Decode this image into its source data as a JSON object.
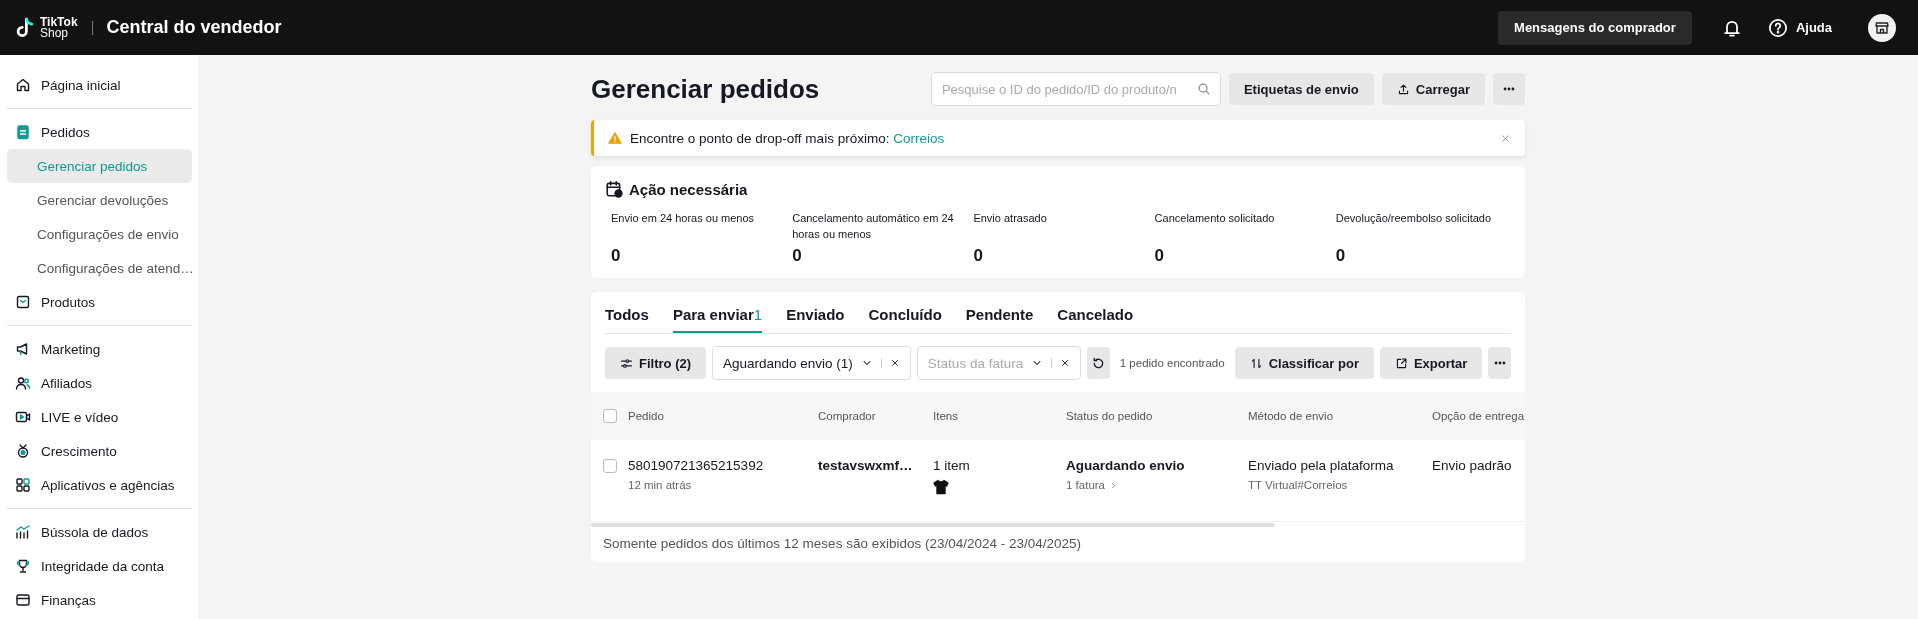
{
  "header": {
    "logo_top": "TikTok",
    "logo_bottom": "Shop",
    "title": "Central do vendedor",
    "messages_button": "Mensagens do comprador",
    "help": "Ajuda"
  },
  "sidebar": {
    "groups": [
      [
        {
          "label": "Página inicial"
        }
      ],
      [
        {
          "label": "Pedidos",
          "children": [
            {
              "label": "Gerenciar pedidos",
              "selected": true
            },
            {
              "label": "Gerenciar devoluções",
              "selected": false
            },
            {
              "label": "Configurações de envio",
              "selected": false
            },
            {
              "label": "Configurações de atend…",
              "selected": false
            }
          ]
        },
        {
          "label": "Produtos"
        }
      ],
      [
        {
          "label": "Marketing"
        },
        {
          "label": "Afiliados"
        },
        {
          "label": "LIVE e vídeo"
        },
        {
          "label": "Crescimento"
        },
        {
          "label": "Aplicativos e agências"
        }
      ],
      [
        {
          "label": "Bússola de dados"
        },
        {
          "label": "Integridade da conta"
        },
        {
          "label": "Finanças"
        }
      ]
    ]
  },
  "page": {
    "title": "Gerenciar pedidos",
    "search": {
      "placeholder": "Pesquise o ID do pedido/ID do produto/n"
    },
    "buttons": [
      "Etiquetas de envio",
      "Carregar"
    ]
  },
  "alert": {
    "text": "Encontre o ponto de drop-off mais próximo:",
    "link": "Correios"
  },
  "action_needed": {
    "title": "Ação necessária",
    "metrics": [
      {
        "label": "Envio em 24 horas ou menos",
        "value": "0"
      },
      {
        "label": "Cancelamento automático em 24 horas ou menos",
        "value": "0"
      },
      {
        "label": "Envio atrasado",
        "value": "0"
      },
      {
        "label": "Cancelamento solicitado",
        "value": "0"
      },
      {
        "label": "Devolução/reembolso solicitado",
        "value": "0"
      }
    ]
  },
  "tabs": [
    {
      "label": "Todos",
      "selected": false
    },
    {
      "label": "Para enviar",
      "count": "1",
      "selected": true
    },
    {
      "label": "Enviado",
      "selected": false
    },
    {
      "label": "Concluído",
      "selected": false
    },
    {
      "label": "Pendente",
      "selected": false
    },
    {
      "label": "Cancelado",
      "selected": false
    }
  ],
  "filters": {
    "filter_button": "Filtro",
    "filter_count": "(2)",
    "dropdowns": [
      {
        "value": "Aguardando envio (1)"
      },
      {
        "placeholder": "Status da fatura"
      }
    ],
    "result": "1 pedido encontrado",
    "sort_button": "Classificar por",
    "export_button": "Exportar"
  },
  "table": {
    "columns": [
      "Pedido",
      "Comprador",
      "Itens",
      "Status do pedido",
      "Método de envio",
      "Opção de entrega"
    ],
    "all_checked": false,
    "rows": [
      {
        "checked": false,
        "order_id": "580190721365215392",
        "time": "12 min atrás",
        "buyer": "testavswxmf…",
        "items": "1 item",
        "status": "Aguardando envio",
        "invoice": "1 fatura",
        "shipping": "Enviado pela plataforma",
        "carrier": "TT Virtual#Correios",
        "delivery": "Envio padrão"
      }
    ]
  },
  "footer_note": "Somente pedidos dos últimos 12 meses são exibidos (23/04/2024 - 23/04/2025)"
}
